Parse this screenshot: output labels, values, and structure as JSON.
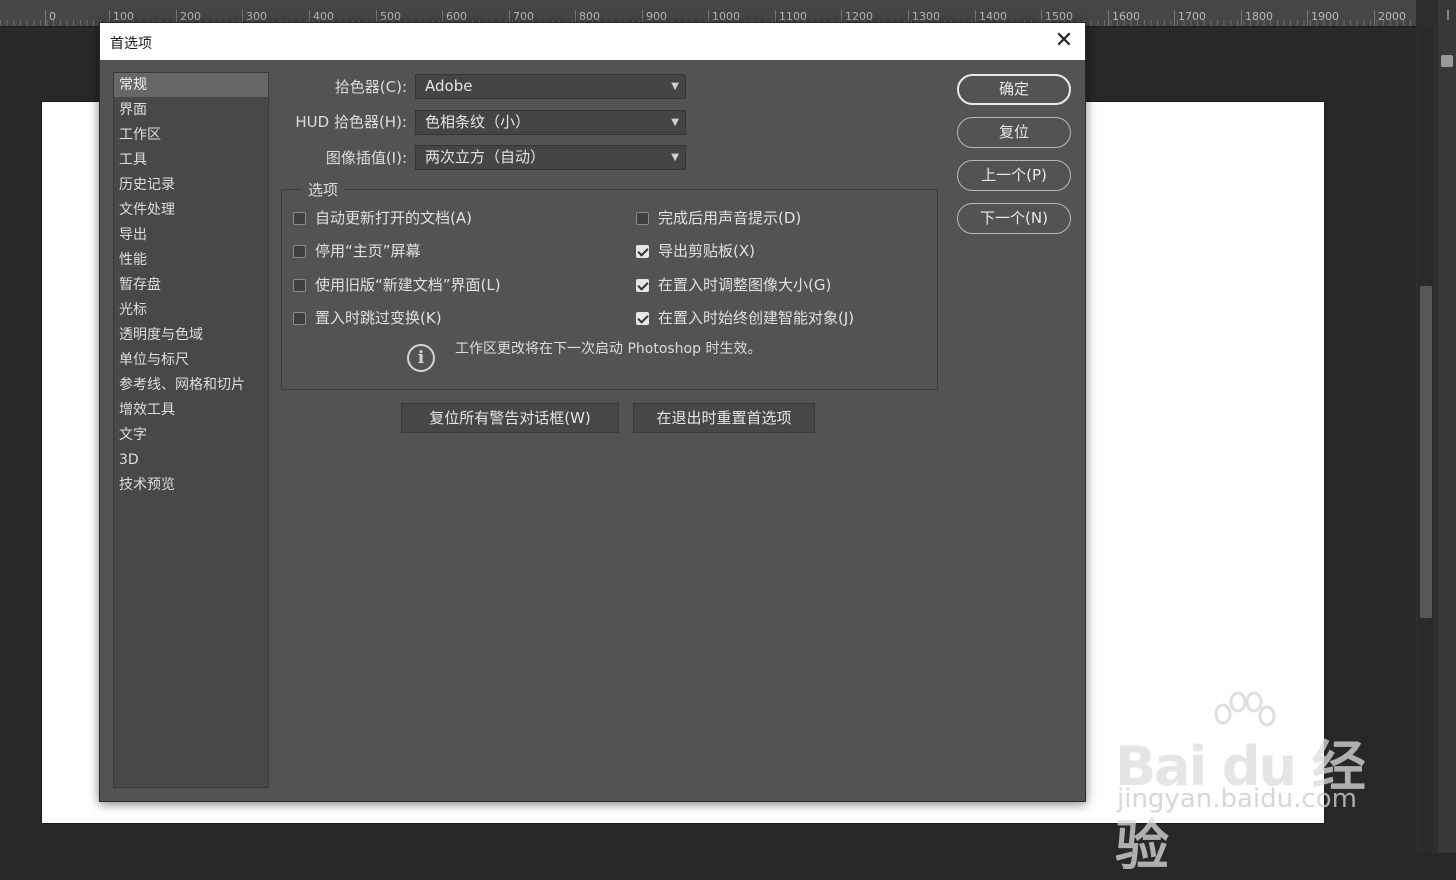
{
  "ruler": {
    "ticks": [
      "0",
      "100",
      "200",
      "300",
      "400",
      "500",
      "600",
      "700",
      "800",
      "900",
      "1000",
      "1100",
      "1200",
      "1300",
      "1400",
      "1500",
      "1600",
      "1700",
      "1800",
      "1900",
      "2000"
    ]
  },
  "dialog": {
    "title": "首选项",
    "close_glyph": "✕",
    "sidebar": {
      "items": [
        "常规",
        "界面",
        "工作区",
        "工具",
        "历史记录",
        "文件处理",
        "导出",
        "性能",
        "暂存盘",
        "光标",
        "透明度与色域",
        "单位与标尺",
        "参考线、网格和切片",
        "增效工具",
        "文字",
        "3D",
        "技术预览"
      ],
      "selected": "常规"
    },
    "fields": [
      {
        "label": "拾色器(C):",
        "value": "Adobe"
      },
      {
        "label": "HUD 拾色器(H):",
        "value": "色相条纹（小）"
      },
      {
        "label": "图像插值(I):",
        "value": "两次立方（自动）"
      }
    ],
    "options_group": {
      "legend": "选项",
      "left": [
        {
          "label": "自动更新打开的文档(A)",
          "checked": false
        },
        {
          "label": "停用“主页”屏幕",
          "checked": false
        },
        {
          "label": "使用旧版“新建文档”界面(L)",
          "checked": false
        },
        {
          "label": "置入时跳过变换(K)",
          "checked": false
        }
      ],
      "right": [
        {
          "label": "完成后用声音提示(D)",
          "checked": false
        },
        {
          "label": "导出剪贴板(X)",
          "checked": true
        },
        {
          "label": "在置入时调整图像大小(G)",
          "checked": true
        },
        {
          "label": "在置入时始终创建智能对象(J)",
          "checked": true
        }
      ],
      "info": "工作区更改将在下一次启动 Photoshop 时生效。"
    },
    "reset_warnings_label": "复位所有警告对话框(W)",
    "reset_prefs_label": "在退出时重置首选项",
    "buttons": {
      "ok": "确定",
      "reset": "复位",
      "prev": "上一个(P)",
      "next": "下一个(N)"
    }
  },
  "watermark": {
    "brand": "Bai du 经验",
    "url": "jingyan.baidu.com"
  }
}
